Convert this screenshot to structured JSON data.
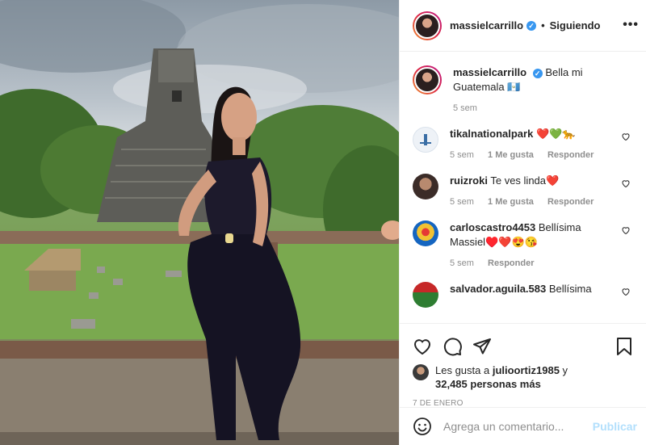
{
  "post": {
    "username": "massielcarrillo",
    "follow_status": "Siguiendo",
    "separator": "•",
    "more_icon": "more-horizontal-icon"
  },
  "caption": {
    "username": "massielcarrillo",
    "text": "Bella mi Guatemala 🇬🇹",
    "time": "5 sem"
  },
  "comments": [
    {
      "username": "tikalnationalpark",
      "text": "❤️💚🐆",
      "time": "5 sem",
      "likes": "1 Me gusta",
      "reply": "Responder",
      "avatar_color": "#e9eef5"
    },
    {
      "username": "ruizroki",
      "text": "Te ves linda❤️",
      "time": "5 sem",
      "likes": "1 Me gusta",
      "reply": "Responder",
      "avatar_color": "#3b2c28"
    },
    {
      "username": "carloscastro4453",
      "text": "Bellísima Massiel♥️❤️😍😘",
      "time": "5 sem",
      "likes": "",
      "reply": "Responder",
      "avatar_color": "#f1c232"
    },
    {
      "username": "salvador.aguila.583",
      "text": "Bellísima",
      "time": "",
      "likes": "",
      "reply": "",
      "avatar_color": "#2e7d32"
    }
  ],
  "likes": {
    "prefix": "Les gusta a",
    "user": "julioortiz1985",
    "conj": "y",
    "count_text": "32,485 personas más"
  },
  "date": "7 DE ENERO",
  "add_comment": {
    "placeholder": "Agrega un comentario...",
    "publish": "Publicar"
  },
  "colors": {
    "accent": "#3897f0",
    "border": "#efefef",
    "muted": "#8e8e8e",
    "publish_disabled": "#b2dffc"
  }
}
